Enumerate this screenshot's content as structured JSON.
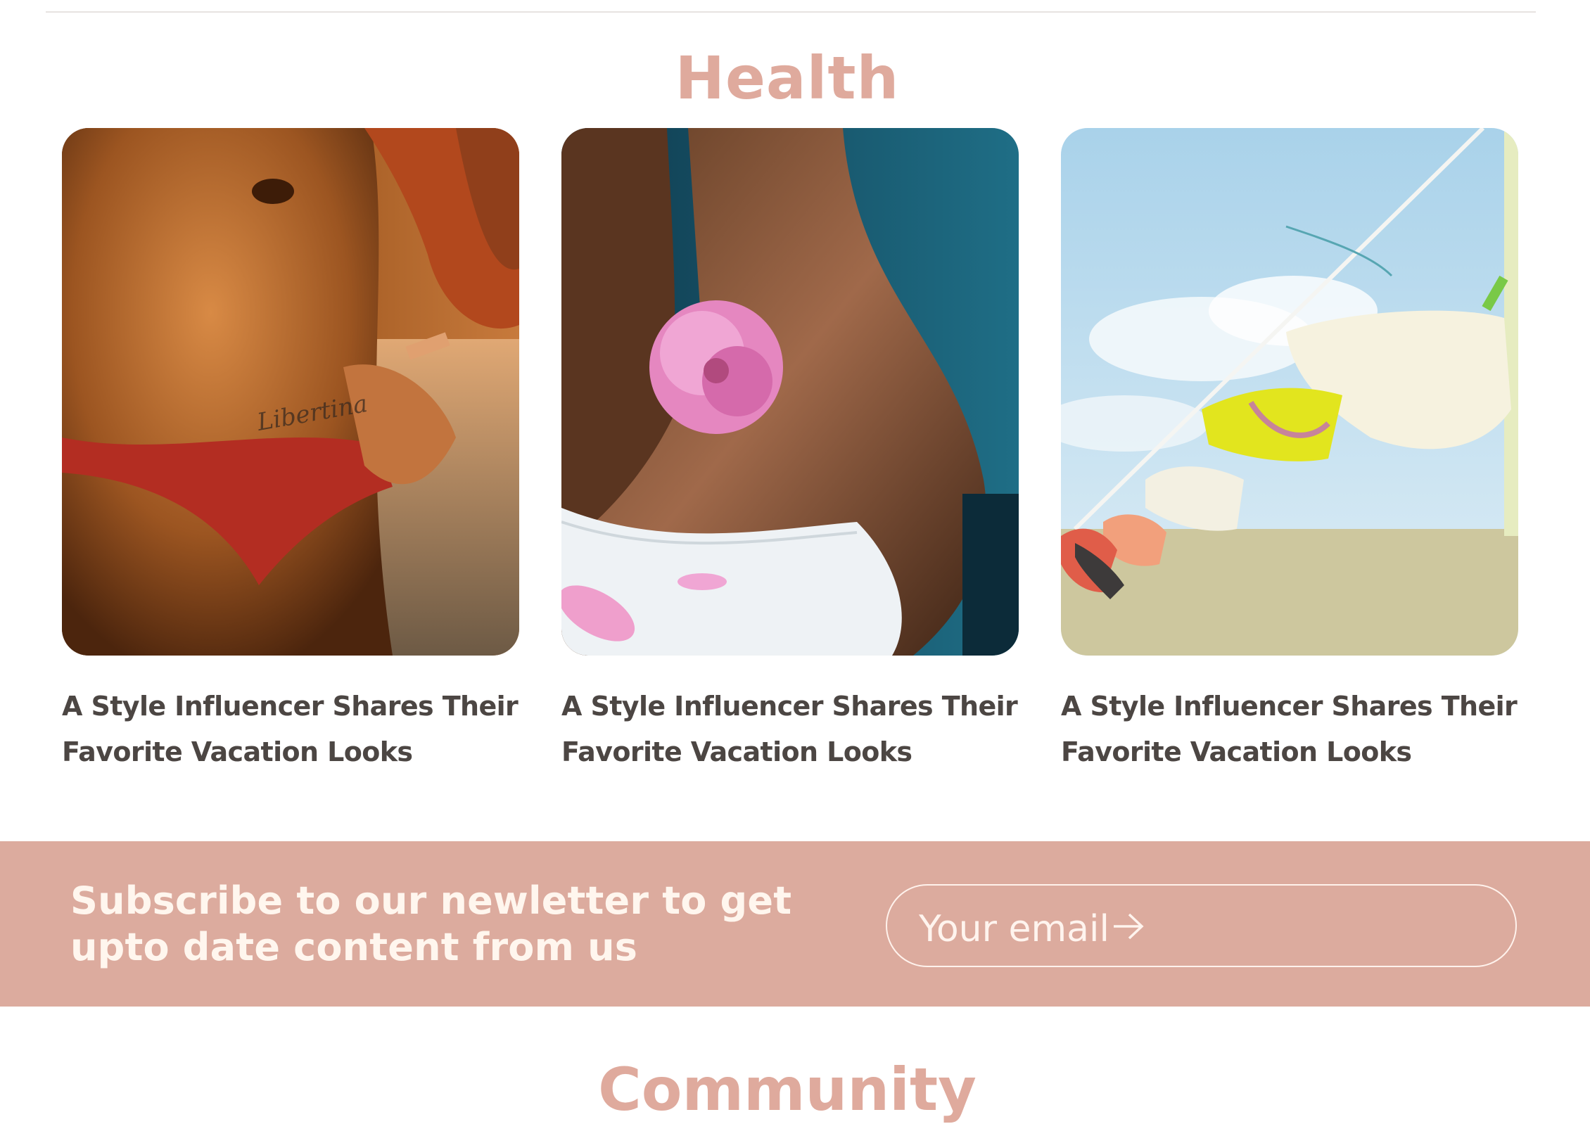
{
  "section": {
    "title": "Health"
  },
  "cards": [
    {
      "title": "A Style Influencer Shares Their Favorite Vacation Looks"
    },
    {
      "title": "A Style Influencer Shares Their Favorite Vacation Looks"
    },
    {
      "title": "A Style Influencer Shares Their Favorite Vacation Looks"
    }
  ],
  "newsletter": {
    "text": "Subscribe to our newletter to get upto date content from us",
    "email_placeholder": "Your email",
    "background_color": "#dcab9e"
  },
  "next_section": {
    "title": "Community"
  },
  "colors": {
    "accent": "#dfaa9d",
    "text": "#4c4643"
  }
}
